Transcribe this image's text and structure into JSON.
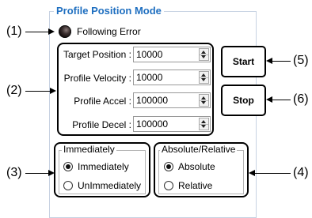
{
  "group_title": "Profile Position Mode",
  "indicator": {
    "label": "Following Error",
    "icon": "led-indicator-icon"
  },
  "params": [
    {
      "label": "Target Position :",
      "value": "10000"
    },
    {
      "label": "Profile Velocity :",
      "value": "10000"
    },
    {
      "label": "Profile Accel :",
      "value": "100000"
    },
    {
      "label": "Profile Decel :",
      "value": "100000"
    }
  ],
  "buttons": {
    "start": "Start",
    "stop": "Stop"
  },
  "immediately_group": {
    "title": "Immediately",
    "options": [
      {
        "label": "Immediately",
        "selected": true
      },
      {
        "label": "UnImmediately",
        "selected": false
      }
    ]
  },
  "absolute_group": {
    "title": "Absolute/Relative",
    "options": [
      {
        "label": "Absolute",
        "selected": true
      },
      {
        "label": "Relative",
        "selected": false
      }
    ]
  },
  "callouts": [
    "(1)",
    "(2)",
    "(3)",
    "(4)",
    "(5)",
    "(6)"
  ]
}
